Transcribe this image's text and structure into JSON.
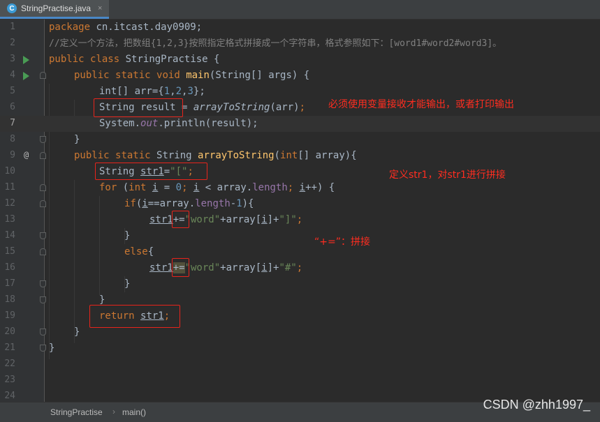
{
  "tab": {
    "icon": "java-class-icon",
    "icon_letter": "C",
    "label": "StringPractise.java",
    "close": "×"
  },
  "code": {
    "line_numbers": [
      "1",
      "2",
      "3",
      "4",
      "5",
      "6",
      "7",
      "8",
      "9",
      "10",
      "11",
      "12",
      "13",
      "14",
      "15",
      "16",
      "17",
      "18",
      "19",
      "20",
      "21",
      "22",
      "23",
      "24"
    ],
    "current_line": "7",
    "l1": {
      "kw": "package",
      "rest": " cn.itcast.day0909;"
    },
    "l2": {
      "comment": "//定义一个方法，把数组{1,2,3}按照指定格式拼接成一个字符串，格式参照如下：[word1#word2#word3]。"
    },
    "l3": {
      "kw1": "public",
      "kw2": "class",
      "name": " StringPractise {"
    },
    "l4": {
      "kw1": "public",
      "kw2": "static",
      "kw3": "void",
      "fn": "main",
      "rest": "(String[] args) {"
    },
    "l5": {
      "type": "int[] arr={",
      "n1": "1",
      "c1": ",",
      "n2": "2",
      "c2": ",",
      "n3": "3",
      "end": "};"
    },
    "l6": {
      "decl": "String result",
      "eq": " = ",
      "call": "arrayToString",
      "args": "(arr)",
      "semi": ";"
    },
    "l7": {
      "sys": "System.",
      "out": "out",
      "rest": ".println(result);"
    },
    "l8": {
      "brace": "}"
    },
    "l9": {
      "kw1": "public",
      "kw2": "static",
      "type": " String ",
      "fn": "arrayToString",
      "p1": "(",
      "kw3": "int",
      "p2": "[] array){"
    },
    "l10": {
      "decl": "String ",
      "var": "str1",
      "eq": "=",
      "str": "\"[\"",
      "semi": ";"
    },
    "l11": {
      "kw1": "for",
      "p1": " (",
      "kw2": "int",
      "sp": " ",
      "i1": "i",
      "mid1": " = ",
      "n0": "0",
      "semi1": "; ",
      "i2": "i",
      "mid2": " < array.",
      "len": "length",
      "semi2": "; ",
      "i3": "i",
      "inc": "++) {"
    },
    "l12": {
      "kw": "if",
      "p1": "(",
      "i": "i",
      "mid": "==array.",
      "len": "length",
      "minus": "-",
      "n1": "1",
      "end": "){"
    },
    "l13": {
      "var": "str1",
      "op": "+=",
      "s1": "\"word\"",
      "mid": "+array[",
      "i": "i",
      "mid2": "]+",
      "s2": "\"]\"",
      "semi": ";"
    },
    "l14": {
      "brace": "}"
    },
    "l15": {
      "kw": "else",
      "brace": "{"
    },
    "l16": {
      "var": "str1",
      "op": "+=",
      "s1": "\"word\"",
      "mid": "+array[",
      "i": "i",
      "mid2": "]+",
      "s2": "\"#\"",
      "semi": ";"
    },
    "l17": {
      "brace": "}"
    },
    "l18": {
      "brace": "}"
    },
    "l19": {
      "kw": "return",
      "sp": " ",
      "var": "str1",
      "semi": ";"
    },
    "l20": {
      "brace": "}"
    },
    "l21": {
      "brace": "}"
    }
  },
  "annotations": {
    "note_result": "必须使用变量接收才能输出，或者打印输出",
    "note_str1": "定义str1，对str1进行拼接",
    "note_plus": "“+=”：拼接",
    "color": "#ff2d20"
  },
  "breadcrumb": {
    "class_name": "StringPractise",
    "separator": "›",
    "method": "main()"
  },
  "watermark": "CSDN @zhh1997_",
  "colors": {
    "keyword": "#cc7832",
    "string": "#6a8759",
    "number": "#6897bb",
    "comment": "#808080",
    "method": "#ffc66d",
    "field": "#9876aa",
    "background": "#2b2b2b"
  }
}
